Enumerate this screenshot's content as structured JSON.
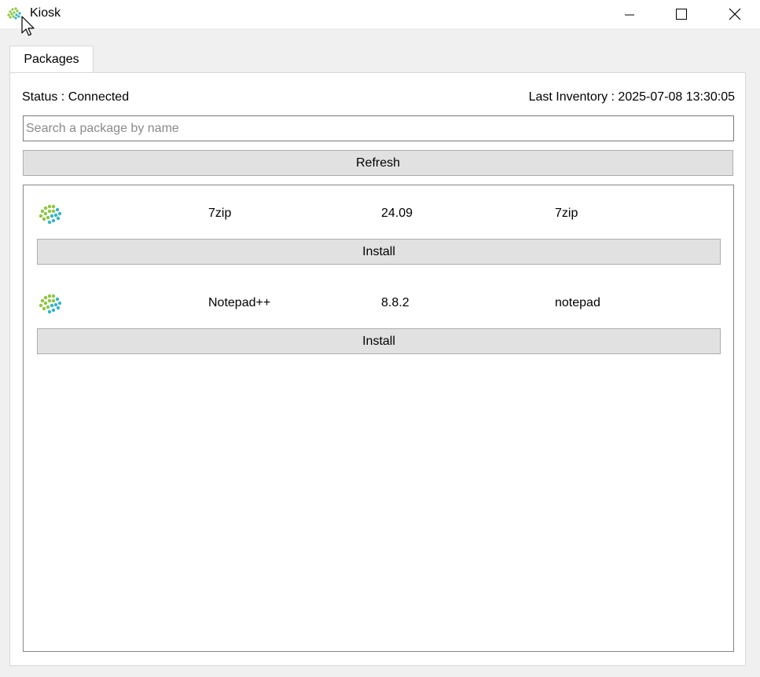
{
  "window": {
    "title": "Kiosk",
    "controls": {
      "minimize": "—",
      "maximize": "☐",
      "close": "✕"
    }
  },
  "tabs": [
    {
      "label": "Packages",
      "active": true
    }
  ],
  "status_text": "Status : Connected",
  "last_inventory_text": "Last Inventory : 2025-07-08 13:30:05",
  "search": {
    "placeholder": "Search a package by name",
    "value": ""
  },
  "refresh_label": "Refresh",
  "packages": [
    {
      "icon": "package-logo-icon",
      "name": "7zip",
      "version": "24.09",
      "id": "7zip",
      "action_label": "Install"
    },
    {
      "icon": "package-logo-icon",
      "name": "Notepad++",
      "version": "8.8.2",
      "id": "notepad",
      "action_label": "Install"
    }
  ],
  "colors": {
    "window_bg": "#f0f0f0",
    "button_bg": "#e1e1e1",
    "button_border": "#adadad",
    "logo_green": "#7cc576",
    "logo_teal": "#2fb1c4"
  }
}
